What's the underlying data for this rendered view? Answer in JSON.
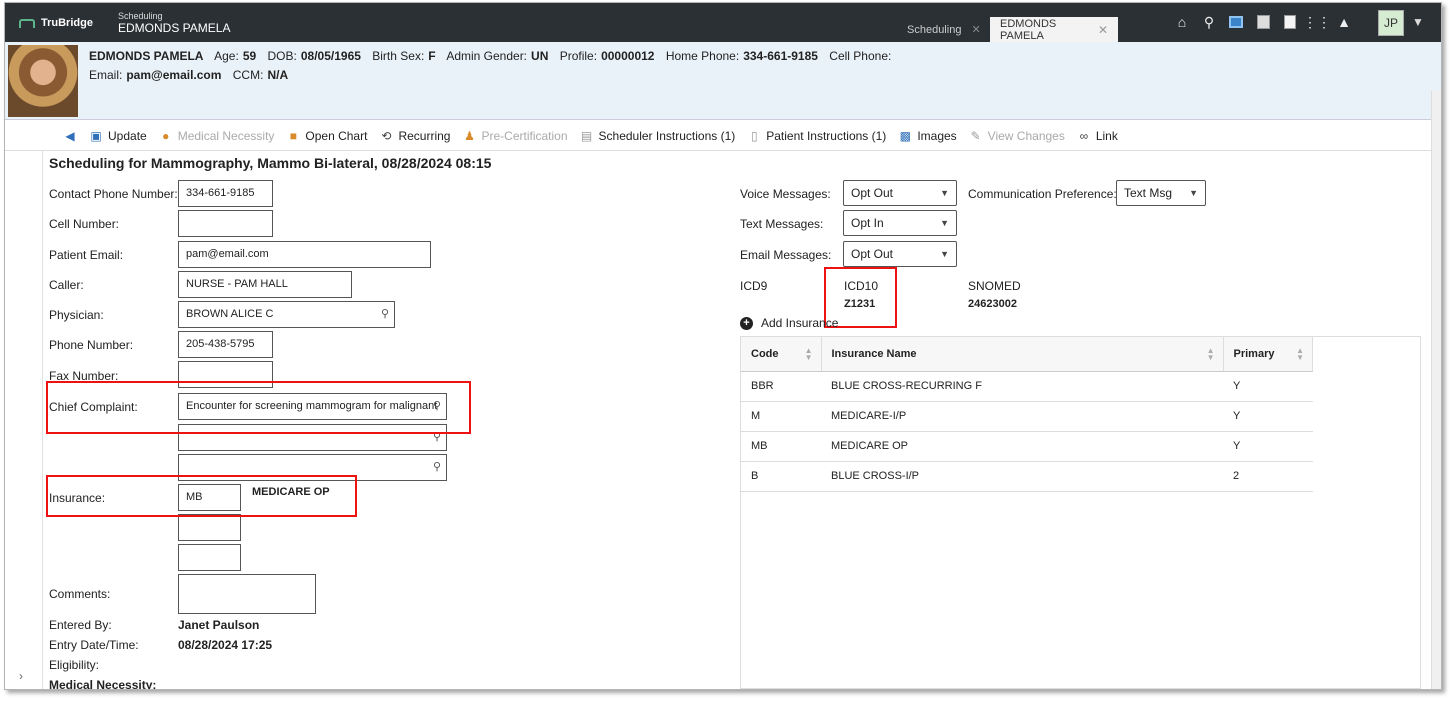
{
  "topbar": {
    "logo": "TruBridge",
    "context_small": "Scheduling",
    "context_name": "EDMONDS PAMELA",
    "tabs": [
      {
        "label": "Scheduling"
      },
      {
        "label": "EDMONDS PAMELA"
      }
    ],
    "user_initials": "JP"
  },
  "patient": {
    "name": "EDMONDS PAMELA",
    "age_label": "Age:",
    "age": "59",
    "dob_label": "DOB:",
    "dob": "08/05/1965",
    "sex_label": "Birth Sex:",
    "sex": "F",
    "gender_label": "Admin Gender:",
    "gender": "UN",
    "profile_label": "Profile:",
    "profile": "00000012",
    "home_phone_label": "Home Phone:",
    "home_phone": "334-661-9185",
    "cell_phone_label": "Cell Phone:",
    "email_label": "Email:",
    "email": "pam@email.com",
    "ccm_label": "CCM:",
    "ccm": "N/A"
  },
  "toolbar": {
    "update": "Update",
    "medical_necessity": "Medical Necessity",
    "open_chart": "Open Chart",
    "recurring": "Recurring",
    "pre_cert": "Pre-Certification",
    "scheduler_instr": "Scheduler Instructions (1)",
    "patient_instr": "Patient Instructions (1)",
    "images": "Images",
    "view_changes": "View Changes",
    "link": "Link"
  },
  "form": {
    "title": "Scheduling for Mammography, Mammo Bi-lateral, 08/28/2024 08:15",
    "contact_phone_label": "Contact Phone Number:",
    "contact_phone": "334-661-9185",
    "cell_label": "Cell Number:",
    "cell": "",
    "email_label": "Patient Email:",
    "email": "pam@email.com",
    "caller_label": "Caller:",
    "caller": "NURSE - PAM HALL",
    "physician_label": "Physician:",
    "physician": "BROWN ALICE C",
    "phone_label": "Phone Number:",
    "phone": "205-438-5795",
    "fax_label": "Fax Number:",
    "fax": "",
    "chief_label": "Chief Complaint:",
    "chief": "Encounter for screening mammogram for malignant",
    "insurance_label": "Insurance:",
    "insurance_code": "MB",
    "insurance_name": "MEDICARE OP",
    "comments_label": "Comments:",
    "entered_by_label": "Entered By:",
    "entered_by": "Janet Paulson",
    "entry_dt_label": "Entry Date/Time:",
    "entry_dt": "08/28/2024 17:25",
    "eligibility_label": "Eligibility:",
    "medical_necessity_label": "Medical Necessity:"
  },
  "messaging": {
    "voice_label": "Voice Messages:",
    "voice": "Opt Out",
    "text_label": "Text Messages:",
    "text": "Opt In",
    "email_label": "Email Messages:",
    "email": "Opt Out",
    "comm_pref_label": "Communication Preference:",
    "comm_pref": "Text Msg"
  },
  "codes": {
    "icd9_label": "ICD9",
    "icd10_label": "ICD10",
    "icd10": "Z1231",
    "snomed_label": "SNOMED",
    "snomed": "24623002"
  },
  "insurance_panel": {
    "add_label": "Add Insurance",
    "columns": [
      "Code",
      "Insurance Name",
      "Primary"
    ],
    "rows": [
      {
        "code": "BBR",
        "name": "BLUE CROSS-RECURRING F",
        "primary": "Y"
      },
      {
        "code": "M",
        "name": "MEDICARE-I/P",
        "primary": "Y"
      },
      {
        "code": "MB",
        "name": "MEDICARE OP",
        "primary": "Y"
      },
      {
        "code": "B",
        "name": "BLUE CROSS-I/P",
        "primary": "2"
      }
    ]
  }
}
